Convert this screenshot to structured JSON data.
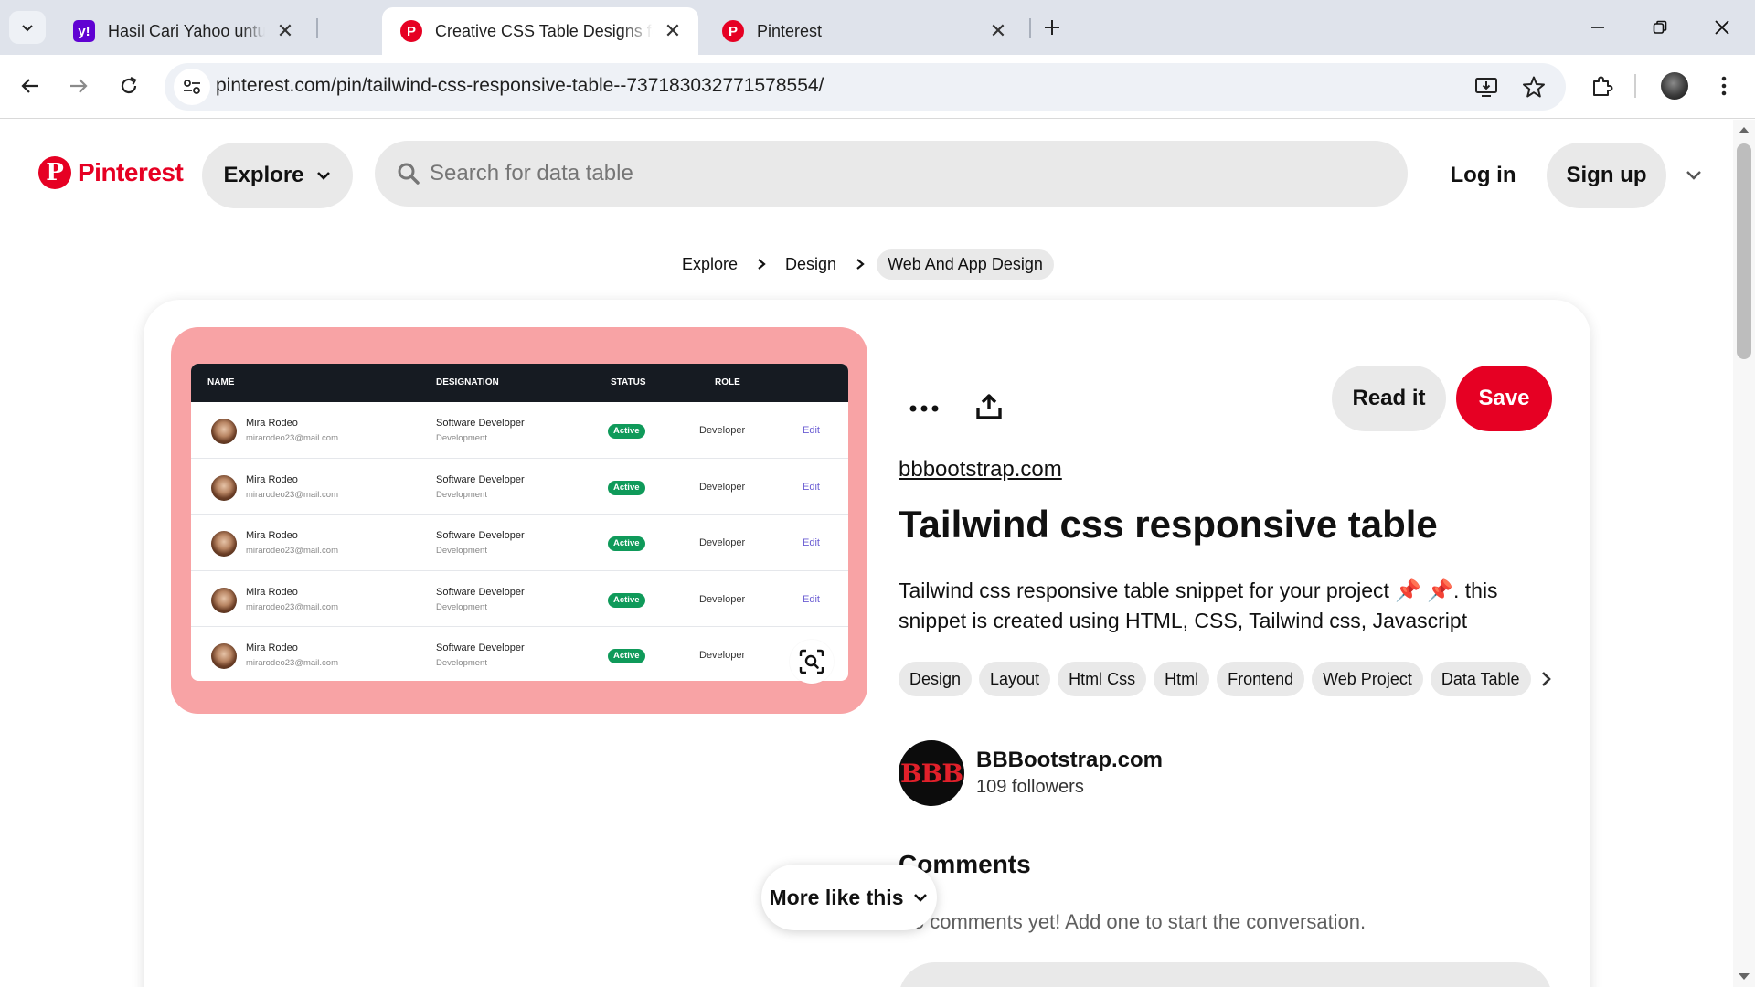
{
  "browser": {
    "tabs": [
      {
        "title": "Hasil Cari Yahoo untuk table html",
        "favicon": "yahoo-icon",
        "active": false
      },
      {
        "title": "Creative CSS Table Designs for Stunning",
        "favicon": "pinterest-icon",
        "active": true
      },
      {
        "title": "Pinterest",
        "favicon": "pinterest-icon",
        "active": false
      }
    ],
    "url": "pinterest.com/pin/tailwind-css-responsive-table--737183032771578554/"
  },
  "header": {
    "logo_text": "Pinterest",
    "explore_label": "Explore",
    "search_placeholder": "Search for data table",
    "login_label": "Log in",
    "signup_label": "Sign up"
  },
  "breadcrumb": [
    "Explore",
    "Design",
    "Web And App Design"
  ],
  "pin": {
    "image": {
      "columns": [
        "NAME",
        "DESIGNATION",
        "STATUS",
        "ROLE"
      ],
      "rows": [
        {
          "name": "Mira Rodeo",
          "email": "mirarodeo23@mail.com",
          "designation": "Software Developer",
          "department": "Development",
          "status": "Active",
          "role": "Developer",
          "action": "Edit"
        },
        {
          "name": "Mira Rodeo",
          "email": "mirarodeo23@mail.com",
          "designation": "Software Developer",
          "department": "Development",
          "status": "Active",
          "role": "Developer",
          "action": "Edit"
        },
        {
          "name": "Mira Rodeo",
          "email": "mirarodeo23@mail.com",
          "designation": "Software Developer",
          "department": "Development",
          "status": "Active",
          "role": "Developer",
          "action": "Edit"
        },
        {
          "name": "Mira Rodeo",
          "email": "mirarodeo23@mail.com",
          "designation": "Software Developer",
          "department": "Development",
          "status": "Active",
          "role": "Developer",
          "action": "Edit"
        },
        {
          "name": "Mira Rodeo",
          "email": "mirarodeo23@mail.com",
          "designation": "Software Developer",
          "department": "Development",
          "status": "Active",
          "role": "Developer",
          "action": ""
        }
      ]
    },
    "read_it_label": "Read it",
    "save_label": "Save",
    "source": "bbbootstrap.com",
    "title": "Tailwind css responsive table",
    "description": "Tailwind css responsive table snippet for your project 📌 📌. this snippet is created using HTML, CSS, Tailwind css, Javascript",
    "tags": [
      "Design",
      "Layout",
      "Html Css",
      "Html",
      "Frontend",
      "Web Project",
      "Data Table"
    ],
    "creator": {
      "avatar_text": "BBB",
      "name": "BBBootstrap.com",
      "followers": "109 followers"
    },
    "comments_title": "Comments",
    "no_comments": "No comments yet! Add one to start the conversation."
  },
  "more_like_this_label": "More like this",
  "colors": {
    "brand_red": "#e60023",
    "pin_background": "#f8a3a5",
    "badge_green": "#0f9a5a"
  }
}
